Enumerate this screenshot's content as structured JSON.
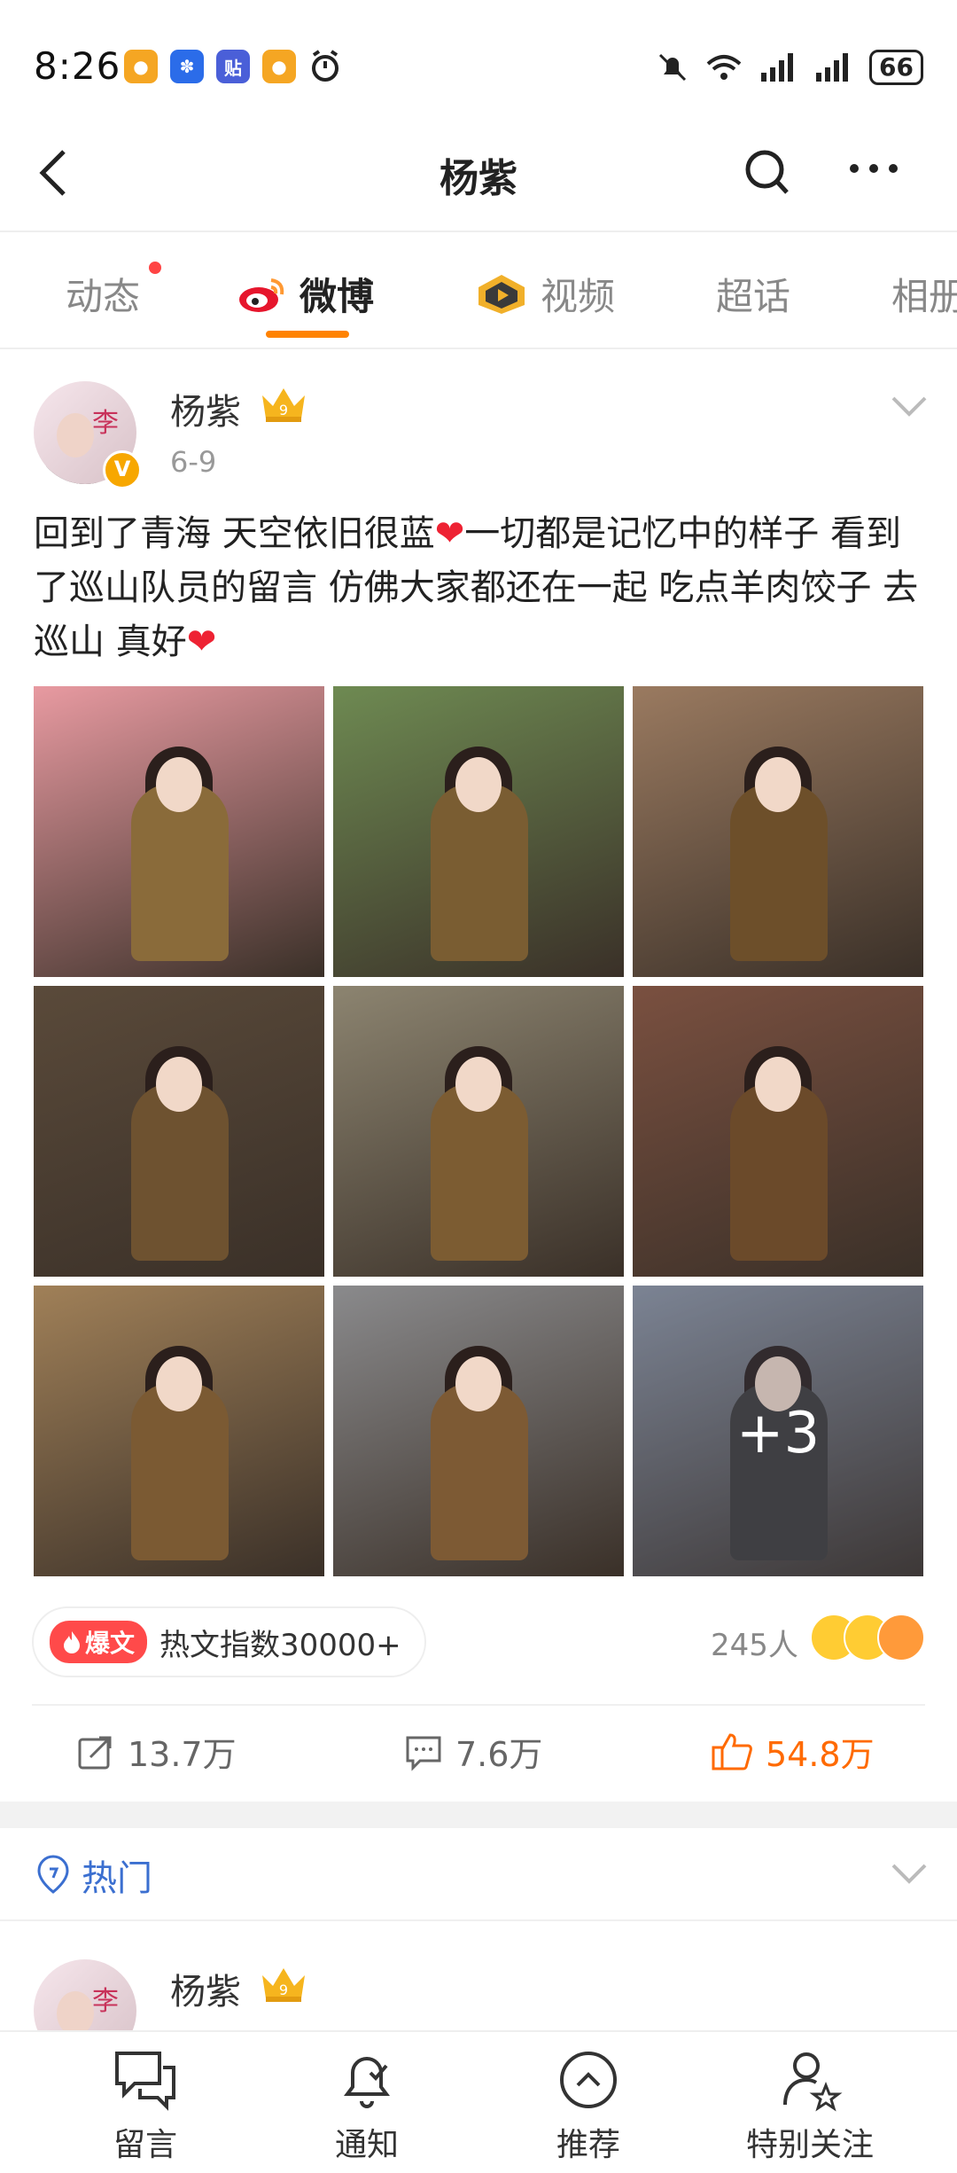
{
  "status_bar": {
    "time": "8:26",
    "apps": [
      "weibo-icon",
      "baidu-icon",
      "tieba-icon",
      "weibo-icon",
      "alarm-icon"
    ],
    "battery": "66"
  },
  "header": {
    "title": "杨紫"
  },
  "tabs": [
    {
      "label": "动态",
      "has_dot": true
    },
    {
      "label": "微博",
      "active": true
    },
    {
      "label": "视频"
    },
    {
      "label": "超话"
    },
    {
      "label": "相册"
    }
  ],
  "post": {
    "author": "杨紫",
    "avatar_text": "李",
    "date": "6-9",
    "text_parts": [
      "回到了青海 天空依旧很蓝",
      "一切都是记忆中的样子 看到了巡山队员的留言 仿佛大家都还在一起 吃点羊肉饺子 去巡山 真好"
    ],
    "heart": "❤",
    "photos": [
      {
        "bg": "#e89aa1",
        "tone": "#8a6b3a"
      },
      {
        "bg": "#6e8a52",
        "tone": "#7a5d32"
      },
      {
        "bg": "#9a7a60",
        "tone": "#6d4f2a"
      },
      {
        "bg": "#5a4a3a",
        "tone": "#6e5230"
      },
      {
        "bg": "#8c8470",
        "tone": "#7c5c32"
      },
      {
        "bg": "#7a5040",
        "tone": "#6b4a2a"
      },
      {
        "bg": "#a08058",
        "tone": "#7b5a33"
      },
      {
        "bg": "#8a8a8c",
        "tone": "#7d5a34"
      },
      {
        "bg": "#8d95a4",
        "tone": "#3c3a38"
      }
    ],
    "more_count": "+3",
    "hot_tag": "爆文",
    "hot_text": "热文指数30000+",
    "reaction_count": "245人",
    "actions": {
      "repost": "13.7万",
      "comment": "7.6万",
      "like": "54.8万"
    },
    "colors": {
      "accent": "#ff8200",
      "like": "#ff6a00",
      "link": "#3b6fd0"
    }
  },
  "hot_section": {
    "label": "热门",
    "author": "杨紫"
  },
  "bottom_bar": [
    {
      "label": "留言",
      "icon": "message-icon"
    },
    {
      "label": "通知",
      "icon": "bell-icon"
    },
    {
      "label": "推荐",
      "icon": "recommend-icon"
    },
    {
      "label": "特别关注",
      "icon": "special-follow-icon"
    }
  ]
}
